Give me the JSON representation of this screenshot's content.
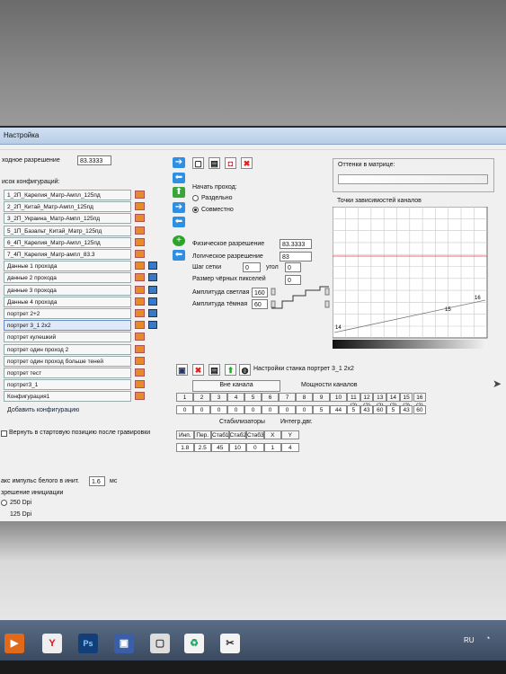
{
  "window": {
    "title": "Настройка"
  },
  "left": {
    "resolution_label": "ходное разрешение",
    "resolution_value": "83.3333",
    "list_title": "исок конфигураций:",
    "configs": [
      "1_2П_Карелия_Матр-Ампл_125пд",
      "2_2П_Китай_Матр-Ампл_125пд",
      "3_2П_Украина_Матр-Ампл_125пд",
      "5_1П_Базальт_Китай_Матр_125пд",
      "6_4П_Карелия_Матр-Ампл_125пд",
      "7_4П_Карелия_Матр-ампл_83.3",
      "Данные 1 прохода",
      "данные 2 прохода",
      "данные 3 прохода",
      "Данные 4 прохода",
      "портрет 2+2",
      "портрет 3_1 2x2",
      "портрет кулешкий",
      "портрет один проход 2",
      "портрет один проход больше теней",
      "портрет тест",
      "портрет3_1",
      "Конфигурация1"
    ],
    "add_config": "Добавить конфигурацию",
    "return_start": "Вернуть в стартовую позицию после гравировки",
    "max_white_label": "акс импульс белого в инит.",
    "max_white_value": "1.6",
    "max_white_unit": "мс",
    "init_res_label": "зрешение инициации",
    "dpi_250": "250 Dpi",
    "dpi_125": "125 Dpi"
  },
  "middle": {
    "start_pass_label": "Начать проход:",
    "opt_separate": "Раздельно",
    "opt_together": "Совместно",
    "phys_res_label": "Физическое разрешение",
    "phys_res_value": "83.3333",
    "log_res_label": "Логическое разрешение",
    "log_res_value": "83",
    "grid_step_label": "Шаг сетки",
    "grid_step_value": "0",
    "angle_label": "угол",
    "angle_value": "0",
    "black_size_label": "Размер чёрных пикселей",
    "black_size_value": "0",
    "amp_light_label": "Амплитуда светлая",
    "amp_light_value": "160",
    "amp_dark_label": "Амплитуда тёмная",
    "amp_dark_value": "60"
  },
  "right": {
    "shade_label": "Оттенки в матрице:",
    "channel_points_label": "Точки зависимостей каналов",
    "point_labels": [
      "16",
      "15",
      "14"
    ]
  },
  "machine": {
    "title": "Настройки станка портрет 3_1 2x2",
    "off_channel": "Вне канала",
    "powers_label": "Мощности каналов",
    "channel_headers": [
      "1",
      "2",
      "3",
      "4",
      "5",
      "6",
      "7",
      "8",
      "9",
      "10",
      "11 (2)",
      "12 (2)",
      "13 (2)",
      "14 (2)",
      "15 (2)",
      "16 (2)"
    ],
    "channel_values": [
      "0",
      "0",
      "0",
      "0",
      "0",
      "0",
      "0",
      "0",
      "5",
      "44",
      "5",
      "43",
      "60",
      "5",
      "43",
      "60"
    ],
    "stabilizers_label": "Стабилизаторы",
    "integr_label": "Интегр.двг.",
    "stab_headers": [
      "Инп.",
      "Пер.",
      "Стаб1",
      "Стаб2",
      "Стаб3",
      "X",
      "Y"
    ],
    "stab_values": [
      "1.8",
      "2.5",
      "45",
      "10",
      "0",
      "1",
      "4"
    ]
  },
  "taskbar": {
    "lang": "RU"
  },
  "colors": {
    "accent": "#2f8fe0",
    "selection": "#dfe9f7",
    "folder": "#e88a2a",
    "chart_line": "#e04040"
  }
}
